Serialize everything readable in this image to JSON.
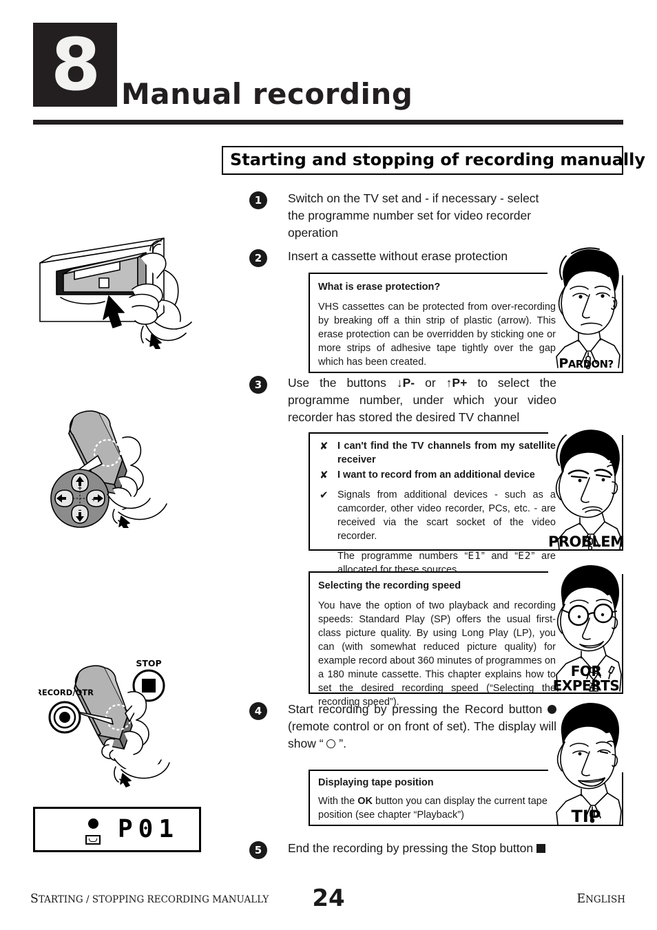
{
  "header": {
    "chapter_number": "8",
    "chapter_title": "Manual recording"
  },
  "section": {
    "title": "Starting and stopping of recording manually"
  },
  "steps": [
    {
      "number": "1",
      "text": "Switch on the TV set and - if necessary -  select the programme number set for video recorder operation"
    },
    {
      "number": "2",
      "text": "Insert a cassette without erase protection"
    },
    {
      "number": "3",
      "text_parts": {
        "lead": "Use the buttons ",
        "key_down": "↓P-",
        "mid": " or ",
        "key_up": "↑P+",
        "tail": " to select the programme number, under which your video recorder has stored the desired TV channel"
      }
    },
    {
      "number": "4",
      "text_parts": {
        "lead": "Start recording by pressing the Record button ",
        "mid": " (remote control or on front of set). The display will show “ ",
        "tail": " ”."
      }
    },
    {
      "number": "5",
      "text_parts": {
        "lead": "End the recording by pressing the Stop button ",
        "tail": ""
      }
    }
  ],
  "boxes": {
    "erase_protection": {
      "title": "What is erase protection?",
      "text": "VHS cassettes can be protected from over-recording by breaking off a thin strip of plastic (arrow). This erase protection can be overridden by sticking one or more strips of adhesive tape tightly over the gap which has been created.",
      "caption": "Pardon?",
      "caption_first": "P",
      "caption_rest": "ARDON?"
    },
    "problem": {
      "items": [
        {
          "mark": "✘",
          "text": "I can't find the TV channels from my satellite receiver",
          "bold": true
        },
        {
          "mark": "✘",
          "text": "I want to record from an additional device",
          "bold": true
        },
        {
          "mark": "✔",
          "text": "Signals from additional devices - such as a camcorder, other video recorder, PCs, etc. - are received via the scart socket of the video recorder.",
          "bold": false
        },
        {
          "mark": "",
          "text_before": "The programme numbers “",
          "lcd1": "E1",
          "text_mid": "” and “",
          "lcd2": "E2",
          "text_after": "” are allocated for these sources.",
          "bold": false
        }
      ],
      "caption": "PROBLEM"
    },
    "recording_speed": {
      "title": "Selecting the recording speed",
      "text": "You have the option of two playback and recording speeds: Standard Play (SP) offers the usual first-class picture quality. By using Long Play (LP), you can (with somewhat reduced picture quality) for example record about 360 minutes of programmes on a 180 minute cassette. This chapter explains how to set the desired recording speed (“Selecting the recording speed”).",
      "caption_line1": "FOR",
      "caption_line2": "EXPERTS"
    },
    "tape_position": {
      "title": "Displaying tape position",
      "text_before": "With the ",
      "key": "OK",
      "text_after": " button you can display the current tape position (see chapter “Playback”)",
      "caption": "TIP"
    }
  },
  "illustrations": {
    "cassette_insert": {
      "name": "cassette insertion into recorder"
    },
    "remote_pplus": {
      "name": "remote control with programme up/down keys",
      "zoom_labels": [
        "+",
        "+",
        "-",
        "-"
      ]
    },
    "remote_record_stop": {
      "name": "remote control with record and stop keys",
      "label_stop": "STOP",
      "label_record": "RECORD/OTR"
    }
  },
  "vcr_display": {
    "programme": "P01",
    "record_indicator": "record-dot",
    "cassette_indicator": "cassette-icon"
  },
  "footer": {
    "left_first": "S",
    "left_rest": "TARTING / STOPPING RECORDING MANUALLY",
    "page": "24",
    "right_first": "E",
    "right_rest": "NGLISH"
  }
}
